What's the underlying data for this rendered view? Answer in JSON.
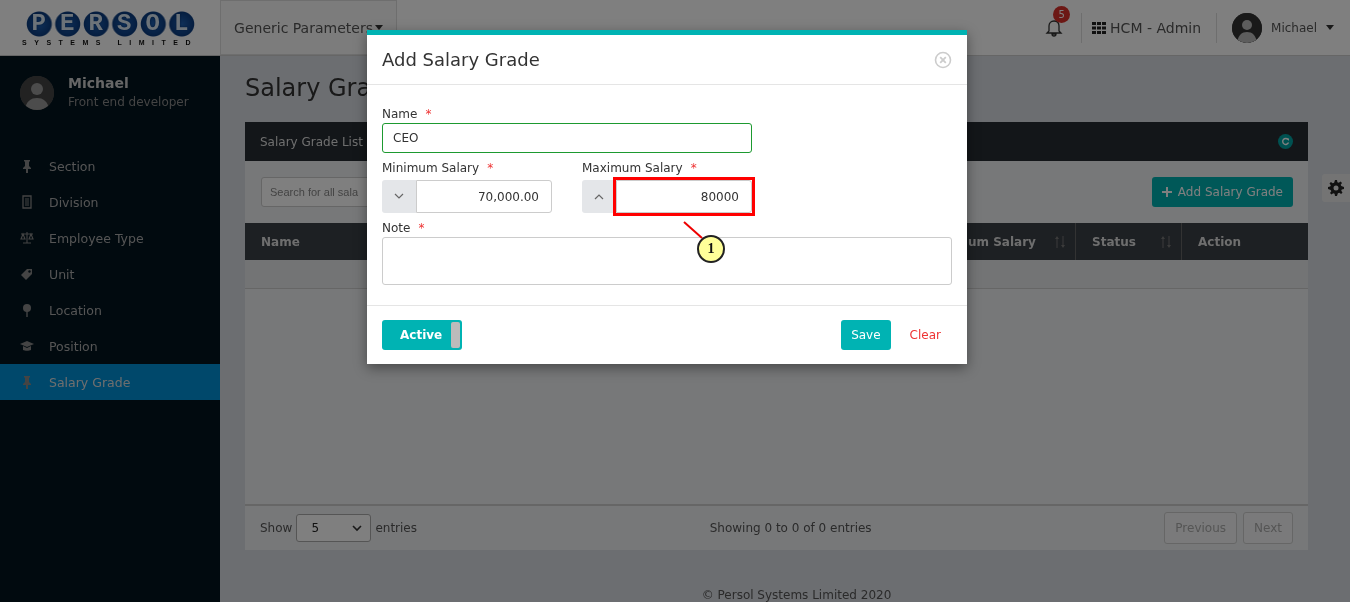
{
  "header": {
    "logo": {
      "title": "PERSOL",
      "subtitle": "SYSTEMS LIMITED"
    },
    "menu": "Generic Parameters",
    "notifications": "5",
    "app": "HCM - Admin",
    "user": "Michael"
  },
  "sidebar": {
    "profile": {
      "name": "Michael",
      "role": "Front end developer"
    },
    "items": [
      {
        "label": "Section",
        "kind": "pin",
        "selected": false
      },
      {
        "label": "Division",
        "kind": "document",
        "selected": false
      },
      {
        "label": "Employee Type",
        "kind": "scale",
        "selected": false
      },
      {
        "label": "Unit",
        "kind": "tag",
        "selected": false
      },
      {
        "label": "Location",
        "kind": "location",
        "selected": false
      },
      {
        "label": "Position",
        "kind": "cap",
        "selected": false
      },
      {
        "label": "Salary Grade",
        "kind": "pin",
        "selected": true
      }
    ]
  },
  "page": {
    "title": "Salary Gra",
    "card_title": "Salary Grade List",
    "search": {
      "placeholder": "Search for all sala"
    },
    "add_button": "Add Salary Grade",
    "columns": [
      {
        "label": "Name"
      },
      {
        "label": "um Salary",
        "sortable": true
      },
      {
        "label": "Status",
        "sortable": true
      },
      {
        "label": "Action",
        "sortable": false
      }
    ],
    "length": {
      "before": "Show",
      "value": "5",
      "after": "entries"
    },
    "info": "Showing 0 to 0 of 0 entries",
    "pager": [
      {
        "label": "Previous",
        "disabled": true
      },
      {
        "label": "Next",
        "disabled": true
      }
    ],
    "footer": "© Persol Systems Limited 2020"
  },
  "modal": {
    "title": "Add Salary Grade",
    "fields": [
      {
        "kind": "text",
        "label": "Name",
        "required_mark": "*",
        "value": "CEO",
        "valid": true
      },
      {
        "kind": "stepdown",
        "label": "Minimum Salary",
        "required_mark": "*",
        "value": "70,000.00",
        "highlighted": false
      },
      {
        "kind": "stepup",
        "label": "Maximum Salary",
        "required_mark": "*",
        "value": "80000",
        "highlighted": true
      },
      {
        "kind": "textarea",
        "label": "Note",
        "required_mark": "*"
      }
    ],
    "toggle": {
      "label": "Active",
      "on": true
    },
    "save": "Save",
    "clear": "Clear"
  },
  "annotation": {
    "label": "1"
  }
}
